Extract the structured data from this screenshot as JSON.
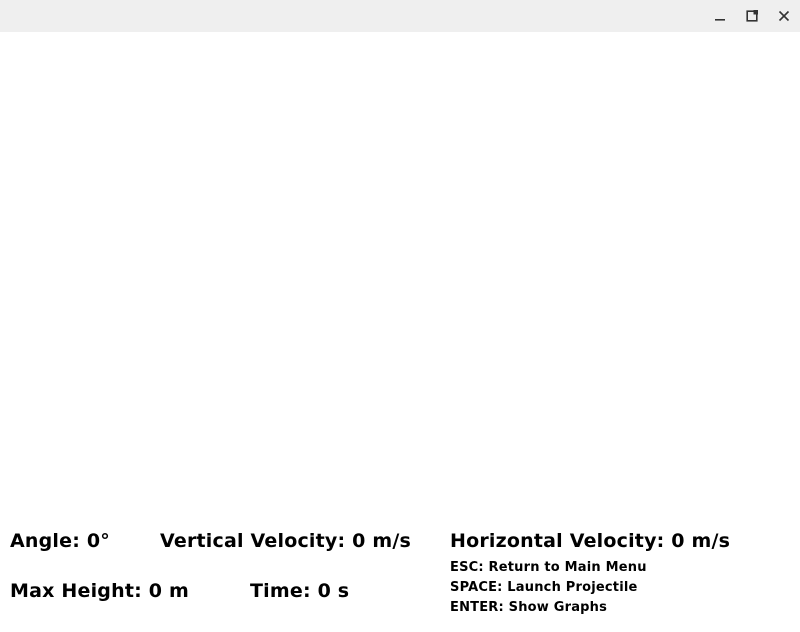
{
  "window": {
    "controls": {
      "minimize_icon": "minimize-icon",
      "maximize_icon": "maximize-icon",
      "close_icon": "close-icon"
    },
    "titlebar_color": "#efefef"
  },
  "stats": {
    "angle": "Angle: 0°",
    "vertical_velocity": "Vertical Velocity: 0 m/s",
    "horizontal_velocity": "Horizontal Velocity: 0 m/s",
    "max_height": "Max Height: 0 m",
    "time": "Time: 0 s"
  },
  "help": {
    "esc": "ESC: Return to Main Menu",
    "space": "SPACE: Launch Projectile",
    "enter": "ENTER: Show Graphs"
  },
  "colors": {
    "background": "#ffffff",
    "text": "#000000"
  }
}
